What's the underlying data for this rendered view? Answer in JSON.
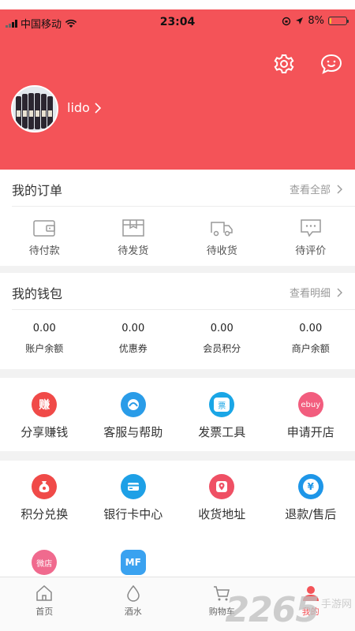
{
  "status_bar": {
    "carrier": "中国移动",
    "time": "23:04",
    "battery": "8%",
    "battery_level": 0.08
  },
  "header": {
    "username": "lido",
    "bg_color": "#f45358",
    "settings_icon": "gear-icon",
    "message_icon": "chat-smile-icon"
  },
  "orders": {
    "title": "我的订单",
    "more": "查看全部",
    "items": [
      {
        "label": "待付款",
        "icon": "wallet-icon"
      },
      {
        "label": "待发货",
        "icon": "box-icon"
      },
      {
        "label": "待收货",
        "icon": "truck-icon"
      },
      {
        "label": "待评价",
        "icon": "comment-icon"
      }
    ]
  },
  "wallet": {
    "title": "我的钱包",
    "more": "查看明细",
    "items": [
      {
        "value": "0.00",
        "label": "账户余额"
      },
      {
        "value": "0.00",
        "label": "优惠券"
      },
      {
        "value": "0.00",
        "label": "会员积分"
      },
      {
        "value": "0.00",
        "label": "商户余额"
      }
    ]
  },
  "services_row1": [
    {
      "label": "分享赚钱",
      "icon_text": "赚",
      "color": "#f04a48"
    },
    {
      "label": "客服与帮助",
      "icon_text": "",
      "color": "#2a9ce8"
    },
    {
      "label": "发票工具",
      "icon_text": "票",
      "color": "#1aa6e6"
    },
    {
      "label": "申请开店",
      "icon_text": "ebuy",
      "color": "#f25d7e"
    }
  ],
  "services_row2": [
    {
      "label": "积分兑换",
      "icon_text": "",
      "color": "#f04a48"
    },
    {
      "label": "银行卡中心",
      "icon_text": "",
      "color": "#1ea0e6"
    },
    {
      "label": "收货地址",
      "icon_text": "",
      "color": "#ef5064"
    },
    {
      "label": "退款/售后",
      "icon_text": "¥",
      "color": "#1e96e8"
    }
  ],
  "services_row3": [
    {
      "label": "",
      "icon_text": "微店",
      "color": "#f06a8e"
    },
    {
      "label": "",
      "icon_text": "MF",
      "color": "#3aa2f0"
    }
  ],
  "tabbar": [
    {
      "label": "首页",
      "icon": "home-icon"
    },
    {
      "label": "酒水",
      "icon": "drop-icon"
    },
    {
      "label": "购物车",
      "icon": "cart-icon"
    },
    {
      "label": "我的",
      "icon": "person-icon",
      "active": true
    }
  ],
  "watermark": {
    "number": "2265",
    "text": "手游网"
  }
}
